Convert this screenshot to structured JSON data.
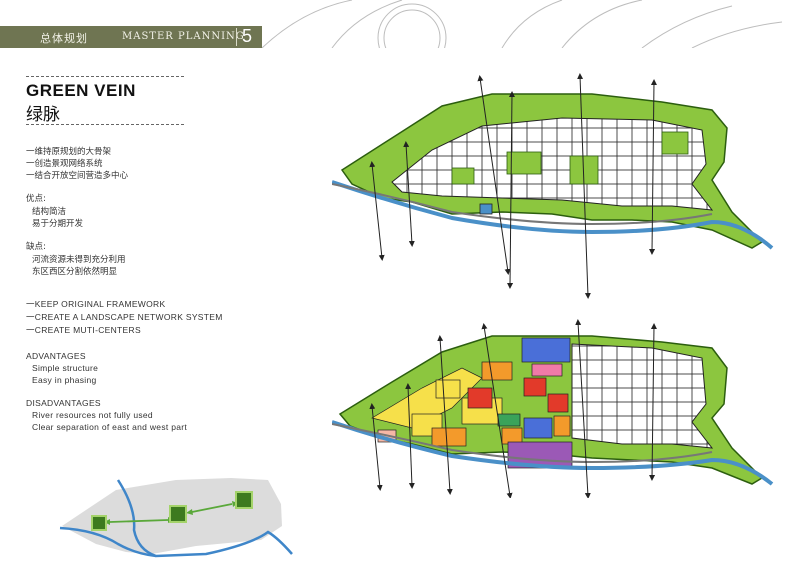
{
  "header": {
    "section_cn": "总体规划",
    "section_en": "MASTER PLANNING",
    "page_number": "5"
  },
  "title": {
    "en": "GREEN VEIN",
    "cn": "绿脉"
  },
  "cn_points": [
    "一维持原规划的大骨架",
    "一创造景观网络系统",
    "一结合开放空间营造多中心"
  ],
  "cn_advantages": {
    "label": "优点:",
    "items": [
      "结构简洁",
      "易于分期开发"
    ]
  },
  "cn_disadvantages": {
    "label": "缺点:",
    "items": [
      "河流资源未得到充分利用",
      "东区西区分割依然明显"
    ]
  },
  "en_points": [
    "一KEEP ORIGINAL FRAMEWORK",
    "一CREATE A LANDSCAPE NETWORK SYSTEM",
    "一CREATE MUTI-CENTERS"
  ],
  "en_advantages": {
    "label": "ADVANTAGES",
    "items": [
      "Simple structure",
      "Easy in phasing"
    ]
  },
  "en_disadvantages": {
    "label": "DISADVANTAGES",
    "items": [
      "River resources not fully used",
      "Clear separation of east and west part"
    ]
  },
  "colors": {
    "header_bg": "#6f7552",
    "green": "#8cc63f",
    "river": "#4a90c8",
    "yellow": "#f6e04a",
    "orange": "#f39a2b",
    "red": "#e23a2a",
    "blue": "#4a6fd8",
    "purple": "#9b59b6",
    "pink": "#f07aa8"
  },
  "icons": [
    "north-arrow-icon",
    "green-node-icon",
    "axis-arrow-icon"
  ]
}
